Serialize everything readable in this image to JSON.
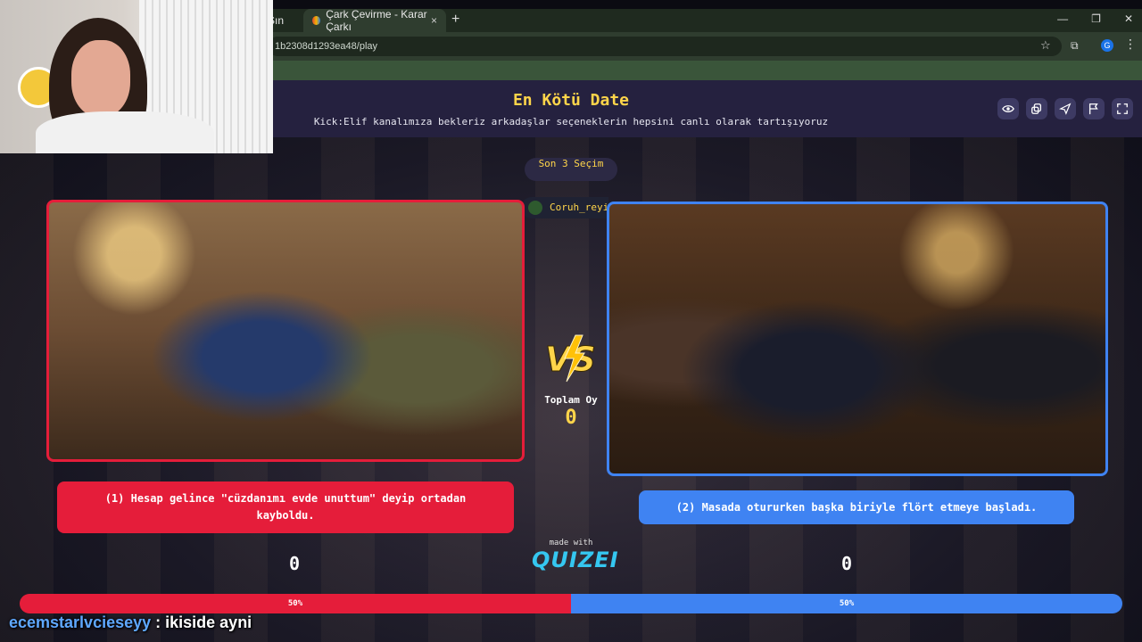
{
  "browser": {
    "tabs": [
      {
        "label": "Sın"
      },
      {
        "label": "Çark Çevirme - Karar Çarkı",
        "close": "×"
      }
    ],
    "new_tab": "+",
    "window_buttons": [
      "—",
      "❐",
      "✕"
    ],
    "url": "1b2308d1293ea48/play",
    "profile_letter": "G"
  },
  "app": {
    "title": "En Kötü Date",
    "subtitle": "Kick:Elif kanalımıza bekleriz arkadaşlar seçeneklerin hepsini canlı olarak tartışıyoruz",
    "header_buttons": [
      "eye-icon",
      "copy-icon",
      "send-icon",
      "flag-icon",
      "fullscreen-icon"
    ],
    "recent_button": "Son 3 Seçim",
    "recent_user": "Coruh_reyis",
    "vs_text": "VS",
    "total_label": "Toplam Oy",
    "total_value": "0",
    "options": [
      {
        "text": "(1) Hesap gelince \"cüzdanımı evde unuttum\" deyip ortadan kayboldu.",
        "score": "0",
        "percent_label": "50%",
        "color": "#e51d3a"
      },
      {
        "text": "(2) Masada otururken başka biriyle flört etmeye başladı.",
        "score": "0",
        "percent_label": "50%",
        "color": "#3f83f2"
      }
    ],
    "made_with": "made with",
    "brand": "QUIZEI",
    "accent": "#ffd54a"
  },
  "chat": {
    "username": "ecemstarlvcieseyy",
    "message": " : ikiside ayni"
  }
}
